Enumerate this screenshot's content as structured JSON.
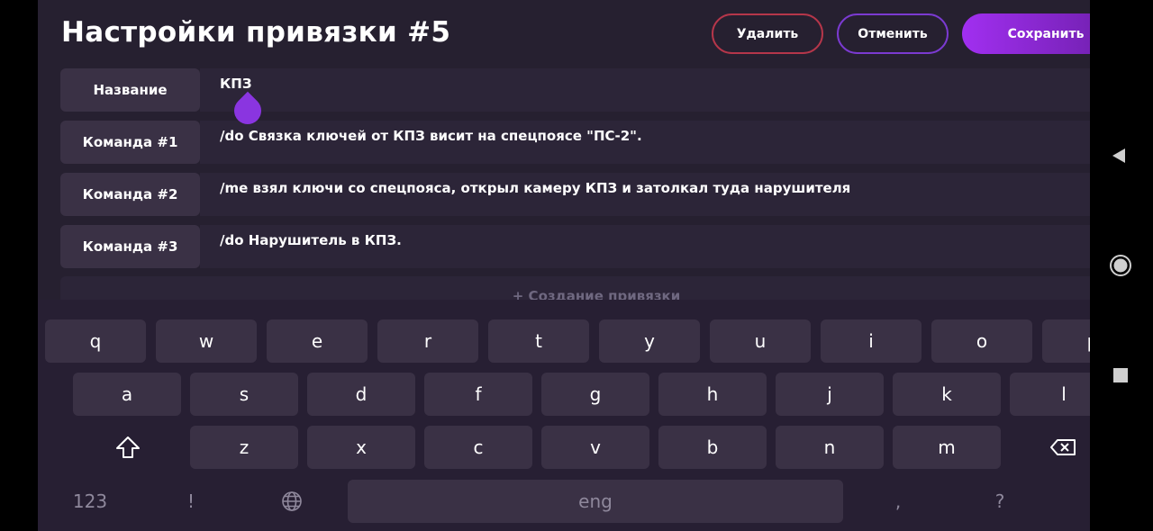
{
  "header": {
    "title": "Настройки привязки #5",
    "delete_label": "Удалить",
    "cancel_label": "Отменить",
    "save_label": "Сохранить"
  },
  "rows": [
    {
      "label": "Название",
      "value": "КПЗ"
    },
    {
      "label": "Команда #1",
      "value": "/do Связка ключей от КПЗ висит на спецпоясе \"ПС-2\"."
    },
    {
      "label": "Команда #2",
      "value": "/me взял ключи со спецпояса, открыл камеру КПЗ и затолкал туда нарушителя"
    },
    {
      "label": "Команда #3",
      "value": "/do Нарушитель в КПЗ."
    }
  ],
  "create_binding_label": "+ Создание привязки",
  "keyboard": {
    "row1": [
      "q",
      "w",
      "e",
      "r",
      "t",
      "y",
      "u",
      "i",
      "o",
      "p"
    ],
    "row2": [
      "a",
      "s",
      "d",
      "f",
      "g",
      "h",
      "j",
      "k",
      "l"
    ],
    "row3": [
      "z",
      "x",
      "c",
      "v",
      "b",
      "n",
      "m"
    ],
    "numbers_key": "123",
    "exclaim_key": "!",
    "space_label": "eng",
    "comma_key": ",",
    "question_key": "?",
    "slash_key": "/"
  },
  "colors": {
    "accent": "#8a35e0",
    "delete_border": "#b5364a",
    "background": "#262030"
  },
  "icons": [
    "close-icon",
    "shift-icon",
    "backspace-icon",
    "globe-icon",
    "back-nav-icon",
    "home-nav-icon",
    "recents-nav-icon"
  ]
}
